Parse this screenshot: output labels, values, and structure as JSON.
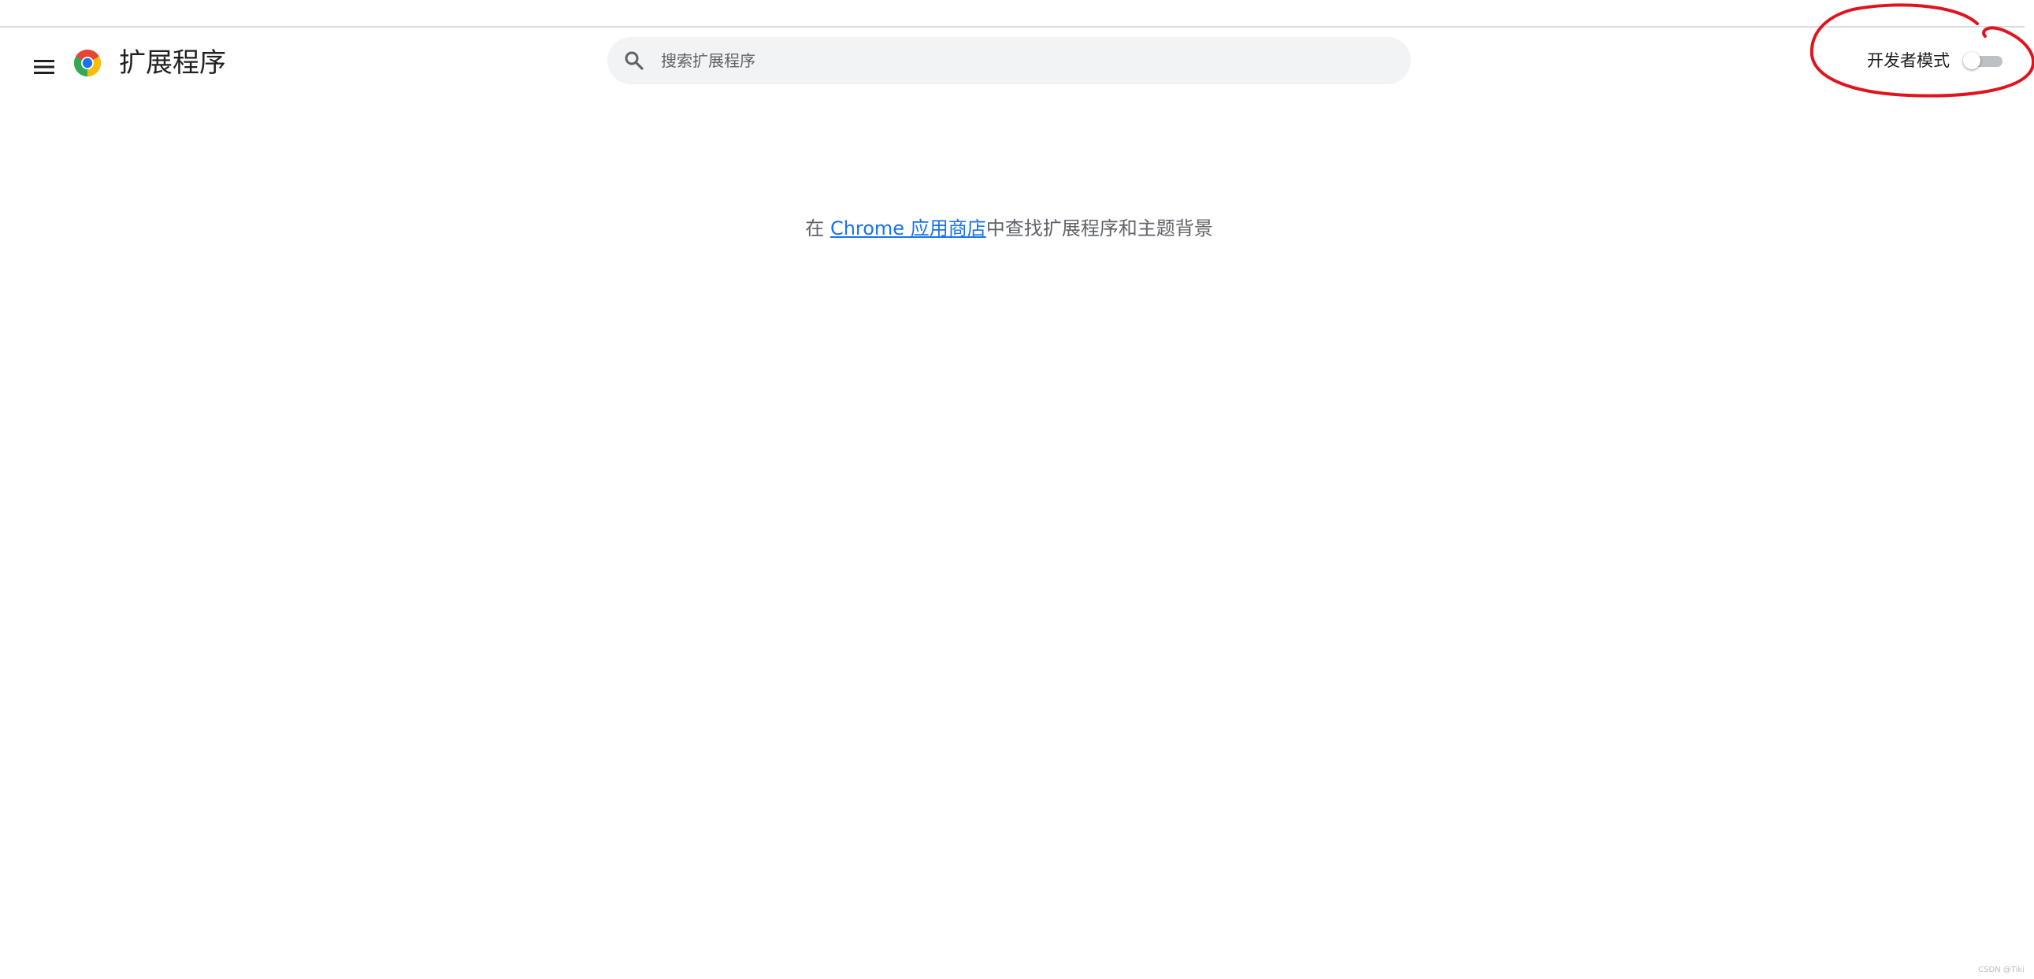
{
  "header": {
    "title": "扩展程序",
    "menu_icon": "hamburger-menu-icon",
    "logo_icon": "chrome-logo-icon"
  },
  "search": {
    "placeholder": "搜索扩展程序",
    "value": "",
    "icon": "search-icon"
  },
  "developer_mode": {
    "label": "开发者模式",
    "enabled": false
  },
  "main": {
    "message_prefix": "在 ",
    "store_link_text": "Chrome 应用商店",
    "message_suffix": "中查找扩展程序和主题背景"
  },
  "watermark": "CSDN @Tiki",
  "colors": {
    "link": "#1a73e8",
    "search_bg": "#f1f3f4",
    "toggle_track_off": "#bdc1c6",
    "annotation": "#e0141e"
  }
}
